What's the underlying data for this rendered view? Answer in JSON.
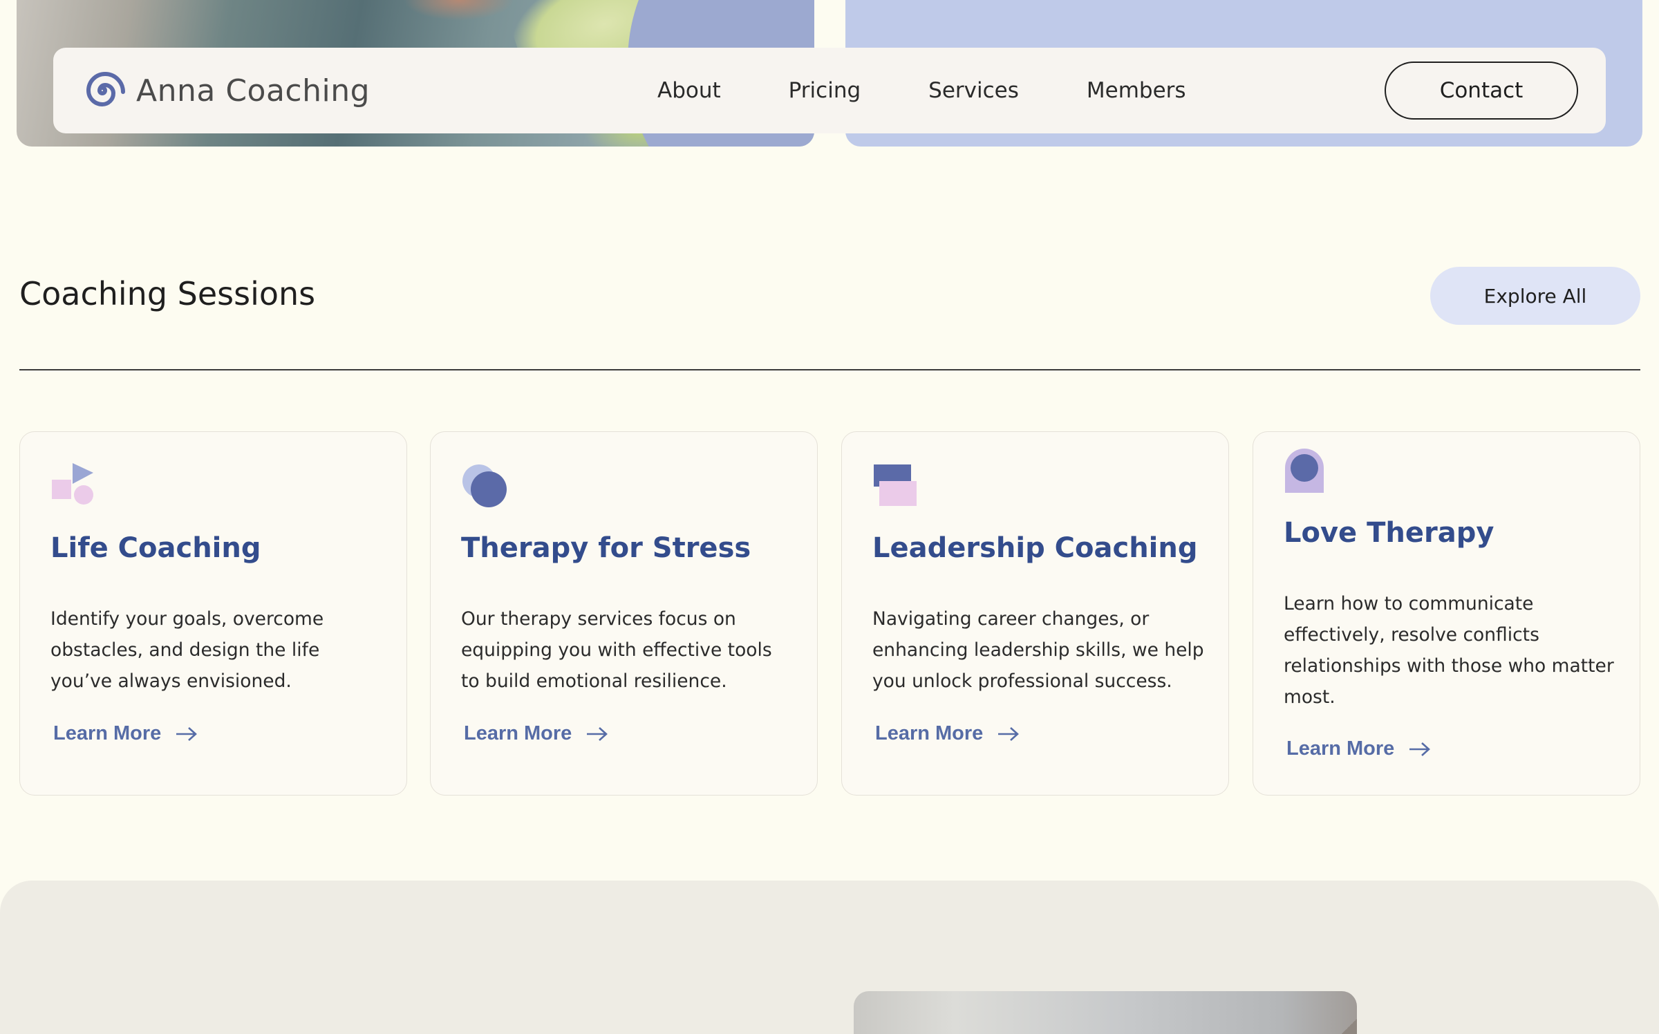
{
  "nav": {
    "brand": "Anna Coaching",
    "links": [
      "About",
      "Pricing",
      "Services",
      "Members"
    ],
    "contact_label": "Contact"
  },
  "sessions": {
    "title": "Coaching Sessions",
    "explore_label": "Explore All",
    "cards": [
      {
        "icon": "shapes-icon",
        "title": "Life Coaching",
        "description": "Identify your goals, overcome obstacles, and design the life you’ve always envisioned.",
        "link_label": "Learn More"
      },
      {
        "icon": "circles-icon",
        "title": "Therapy for Stress",
        "description": "Our therapy services focus on equipping you with effective tools to build emotional resilience.",
        "link_label": "Learn More"
      },
      {
        "icon": "stacked-blocks-icon",
        "title": "Leadership Coaching",
        "description": "Navigating career changes, or enhancing leadership skills, we help you unlock professional success.",
        "link_label": "Learn More"
      },
      {
        "icon": "arch-circle-icon",
        "title": "Love Therapy",
        "description": "Learn how to communicate effectively, resolve conflicts relationships with those who matter most.",
        "link_label": "Learn More"
      }
    ]
  },
  "colors": {
    "background": "#fdfcf1",
    "accent": "#334c8c",
    "link": "#566ca6",
    "hero_right": "#bfcae9",
    "explore_button": "#dfe4f6"
  }
}
